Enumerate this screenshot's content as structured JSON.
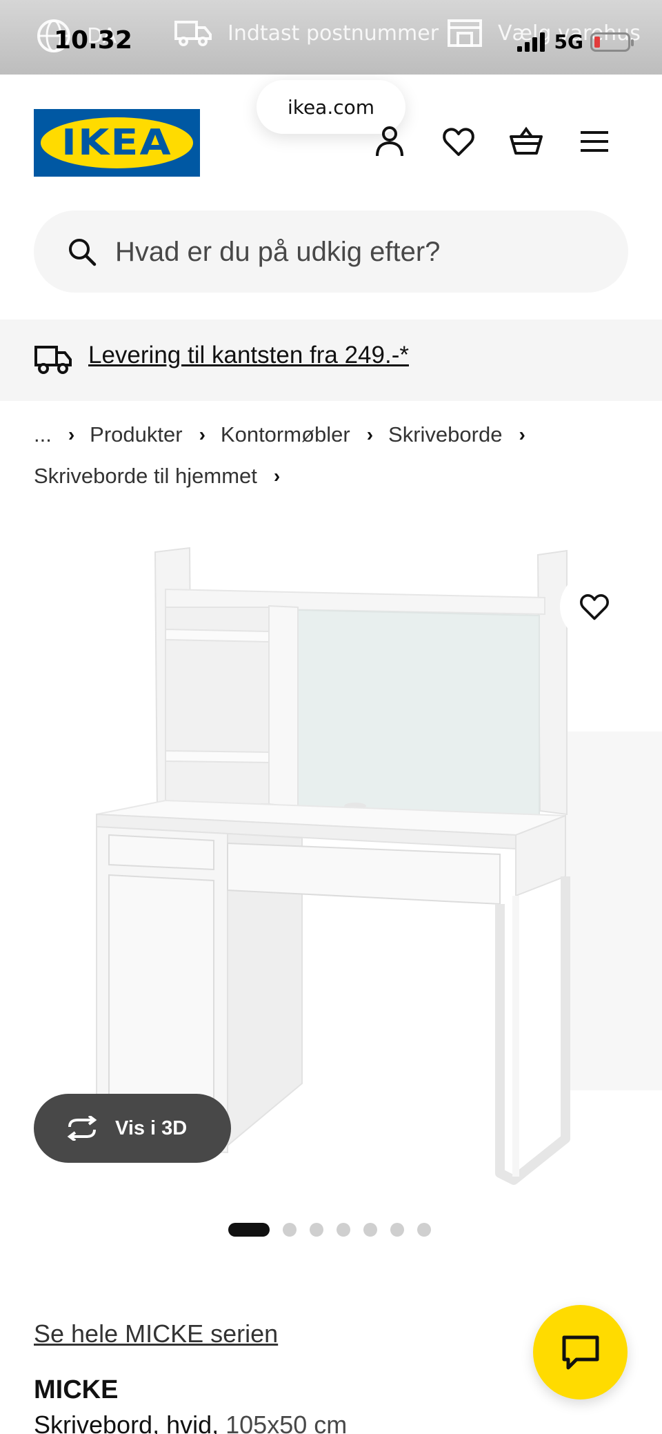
{
  "status_bar": {
    "time": "10.32",
    "network": "5G"
  },
  "top_strip": {
    "language": "DA",
    "postcode_label": "Indtast postnummer",
    "store_label": "Vælg varehus"
  },
  "browser": {
    "url": "ikea.com"
  },
  "header": {
    "logo_text": "IKEA",
    "icons": [
      "profile-icon",
      "heart-icon",
      "basket-icon",
      "menu-icon"
    ]
  },
  "search": {
    "placeholder": "Hvad er du på udkig efter?"
  },
  "delivery_banner": {
    "text": "Levering til kantsten fra 249.-*"
  },
  "breadcrumb": {
    "ellipsis": "...",
    "items": [
      "Produkter",
      "Kontormøbler",
      "Skriveborde",
      "Skriveborde til hjemmet"
    ]
  },
  "gallery": {
    "view_3d_label": "Vis i 3D",
    "image_count": 7,
    "active_index": 0
  },
  "product": {
    "series_link": "Se hele MICKE serien",
    "name": "MICKE",
    "description": "Skrivebord, hvid,",
    "dimensions": "105x50 cm"
  },
  "colors": {
    "brand_blue": "#0058a3",
    "brand_yellow": "#ffdb00",
    "pill_dark": "#484848"
  }
}
